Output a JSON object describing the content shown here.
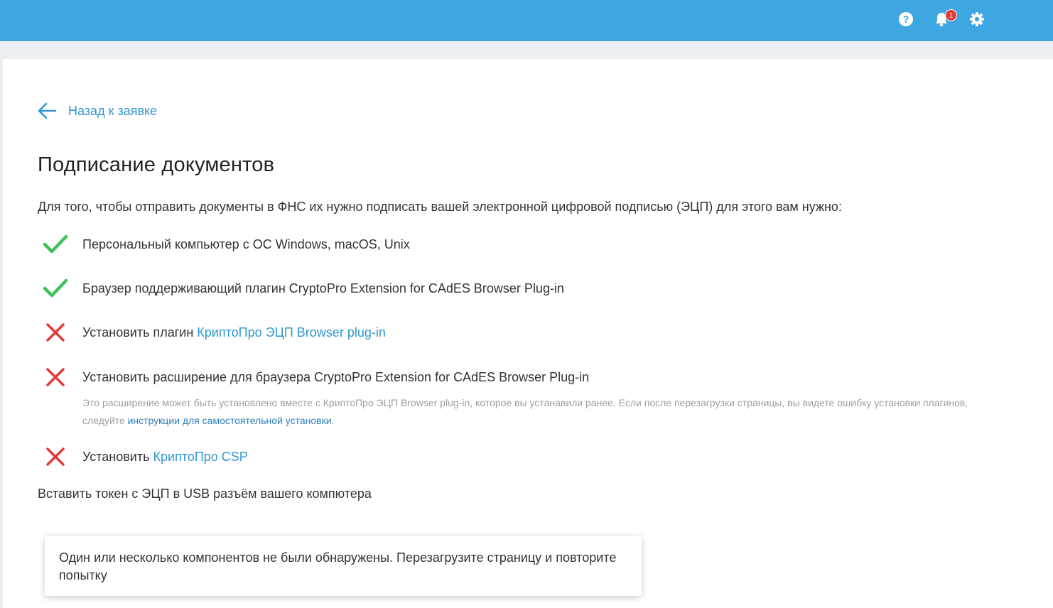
{
  "header": {
    "help_icon": "question-circle-icon",
    "notifications_icon": "bell-icon",
    "notifications_count": "1",
    "settings_icon": "gear-icon",
    "accent_color": "#3ea6e0"
  },
  "back_link": {
    "label": "Назад к заявке"
  },
  "title": "Подписание документов",
  "intro": "Для того, чтобы отправить документы в ФНС их нужно подписать вашей электронной цифровой подписью (ЭЦП) для этого вам нужно:",
  "requirements": [
    {
      "status": "ok",
      "text": "Персональный компьютер с ОС Windows, macOS, Unix"
    },
    {
      "status": "ok",
      "text": "Браузер поддерживающий плагин CryptoPro Extension for CAdES Browser Plug-in"
    },
    {
      "status": "missing",
      "text": "Установить плагин ",
      "link": "КриптоПро ЭЦП Browser plug-in"
    },
    {
      "status": "missing",
      "text": "Установить расширение для браузера CryptoPro Extension for CAdES Browser Plug-in"
    },
    {
      "status": "missing",
      "text": "Установить ",
      "link": "КриптоПро CSP"
    }
  ],
  "note": {
    "text": "Это расширение может быть установлено вместе с КриптоПро ЭЦП Browser plug-in, которое вы устанавили ранее. Если после перезагрузки страницы, вы видете ошибку установки плагинов, следуйте ",
    "link": "инструкции для самостоятельной установки",
    "end": "."
  },
  "usb_step": "Вставить токен с ЭЦП в USB разъём вашего компютера",
  "toast": "Один или несколько компонентов не были обнаружены. Перезагрузите страницу и повторите попытку",
  "colors": {
    "ok": "#3cc15a",
    "missing": "#e53935",
    "link": "#2f97d1"
  }
}
